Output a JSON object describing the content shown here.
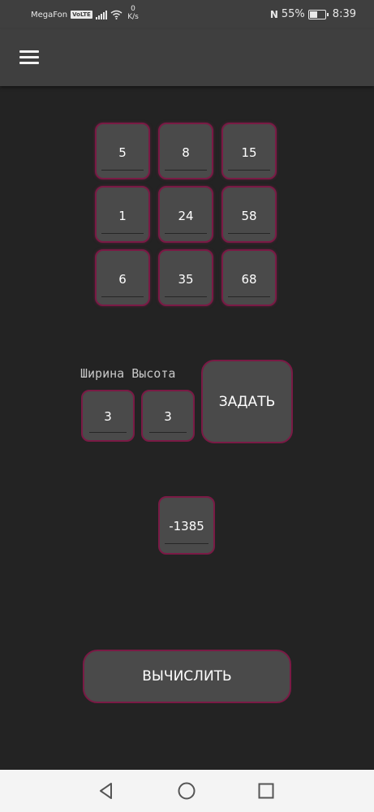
{
  "status_bar": {
    "carrier": "MegaFon",
    "volte": "VoLTE",
    "net_speed_value": "0",
    "net_speed_unit": "K/s",
    "nfc": "N",
    "battery_percent": "55%",
    "battery_level": 0.55,
    "time": "8:39"
  },
  "app_bar": {
    "menu_icon": "hamburger-menu-icon"
  },
  "matrix": {
    "rows": [
      [
        "5",
        "8",
        "15"
      ],
      [
        "1",
        "24",
        "58"
      ],
      [
        "6",
        "35",
        "68"
      ]
    ]
  },
  "dimensions": {
    "width_label": "Ширина",
    "height_label": "Высота",
    "width_value": "3",
    "height_value": "3",
    "set_button": "ЗАДАТЬ"
  },
  "result": {
    "value": "-1385"
  },
  "calculate_button": "ВЫЧИСЛИТЬ",
  "nav_bar": {
    "back_icon": "triangle-back-icon",
    "home_icon": "circle-home-icon",
    "recents_icon": "square-recents-icon"
  },
  "colors": {
    "background": "#232323",
    "bar": "#3f3f3f",
    "field": "#4a4a4a",
    "accent_border": "#7a1a45"
  }
}
